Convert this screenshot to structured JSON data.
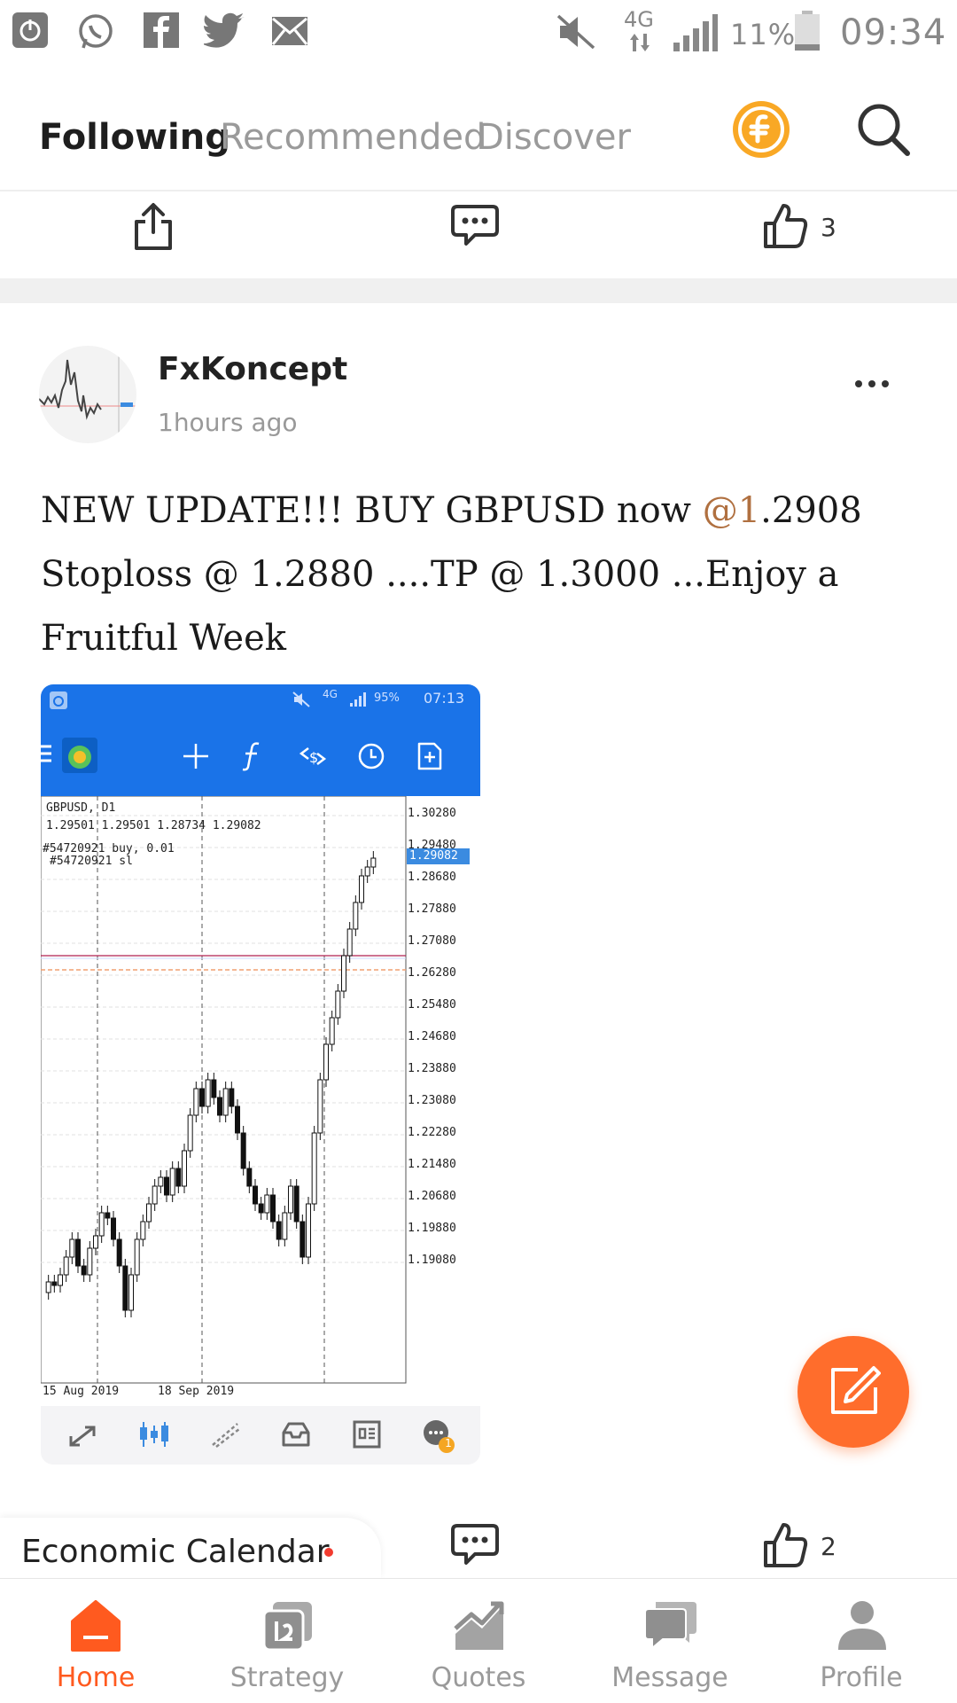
{
  "status_bar": {
    "network": "4G",
    "battery": "11%",
    "time": "09:34"
  },
  "tabs": [
    {
      "label": "Following",
      "active": true
    },
    {
      "label": "Recommended",
      "active": false
    },
    {
      "label": "Discover",
      "active": false
    }
  ],
  "prev_post": {
    "likes": "3"
  },
  "post": {
    "author": "FxKoncept",
    "time_ago": "1hours ago",
    "text_before_mention": "NEW UPDATE!!! BUY GBPUSD now ",
    "mention": "@1",
    "text_after_mention": ".2908 Stoploss @ 1.2880 ....TP @ 1.3000 ...Enjoy a Fruitful Week",
    "likes": "2"
  },
  "chart_image": {
    "status": {
      "network": "4G",
      "battery": "95%",
      "time": "07:13"
    },
    "symbol_line": "GBPUSD, D1",
    "ohlc_line": "1.29501 1.29501 1.28734 1.29082",
    "order_line": "#54720921 buy, 0.01",
    "sl_line": "#54720921 sl",
    "current_price": "1.29082",
    "y_ticks": [
      "1.30280",
      "1.29480",
      "1.28680",
      "1.27880",
      "1.27080",
      "1.26280",
      "1.25480",
      "1.24680",
      "1.23880",
      "1.23080",
      "1.22280",
      "1.21480",
      "1.20680",
      "1.19880",
      "1.19080"
    ],
    "x_ticks": [
      "15 Aug 2019",
      "18 Sep 2019"
    ],
    "chat_badge": "1"
  },
  "economic_calendar": {
    "label": "Economic Calendar"
  },
  "bottom_nav": [
    {
      "label": "Home",
      "active": true,
      "icon": "home-icon"
    },
    {
      "label": "Strategy",
      "active": false,
      "icon": "strategy-icon"
    },
    {
      "label": "Quotes",
      "active": false,
      "icon": "quotes-icon"
    },
    {
      "label": "Message",
      "active": false,
      "icon": "message-icon"
    },
    {
      "label": "Profile",
      "active": false,
      "icon": "profile-icon"
    }
  ],
  "colors": {
    "accent": "#ff5a1f",
    "fab": "#ff6d2c",
    "coin": "#f9a825",
    "mt_blue": "#1a73e8",
    "mention": "#b07040"
  }
}
